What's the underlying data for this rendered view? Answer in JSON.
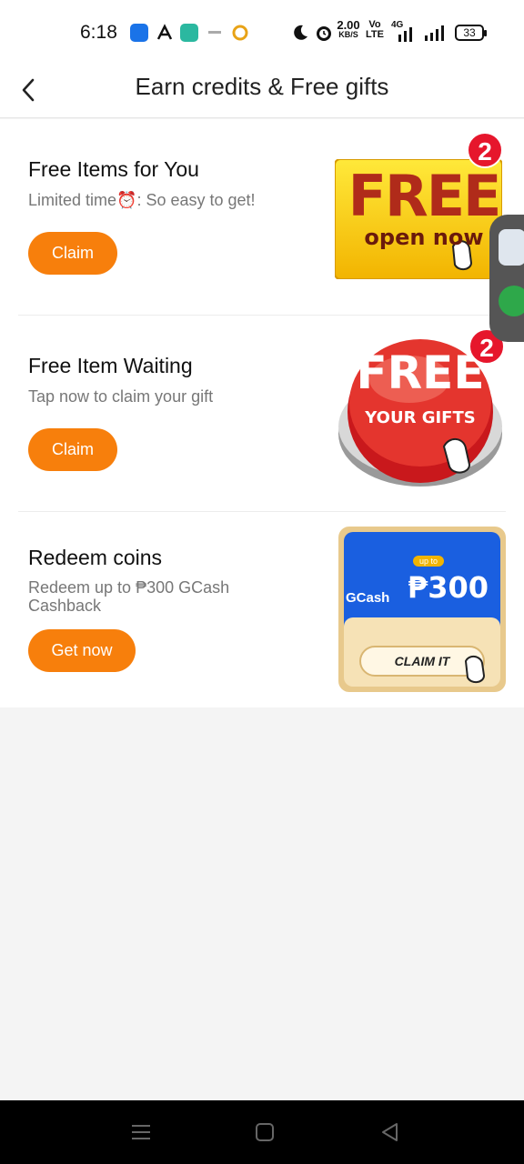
{
  "status": {
    "time": "6:18",
    "net_speed_value": "2.00",
    "net_speed_unit": "KB/S",
    "volte_top": "Vo",
    "volte_bottom": "LTE",
    "network_type": "4G",
    "battery": "33"
  },
  "header": {
    "title": "Earn credits & Free gifts"
  },
  "cards": [
    {
      "title": "Free Items for You",
      "subtitle": "Limited time⏰: So easy to get!",
      "button": "Claim",
      "image_line1": "FREE",
      "image_line2": "open now",
      "badge": "2"
    },
    {
      "title": "Free Item Waiting",
      "subtitle": "Tap now to claim your gift",
      "button": "Claim",
      "image_line1": "FREE",
      "image_line2": "YOUR GIFTS",
      "badge": "2"
    },
    {
      "title": "Redeem coins",
      "subtitle": "Redeem up to ₱300 GCash Cashback",
      "button": "Get now",
      "image_brand": "GCash",
      "image_upto": "up to",
      "image_amount": "₱300",
      "image_cta": "CLAIM IT"
    }
  ],
  "colors": {
    "accent": "#f77f0c",
    "badge": "#e6162c",
    "gcash_blue": "#1a5fe0"
  }
}
